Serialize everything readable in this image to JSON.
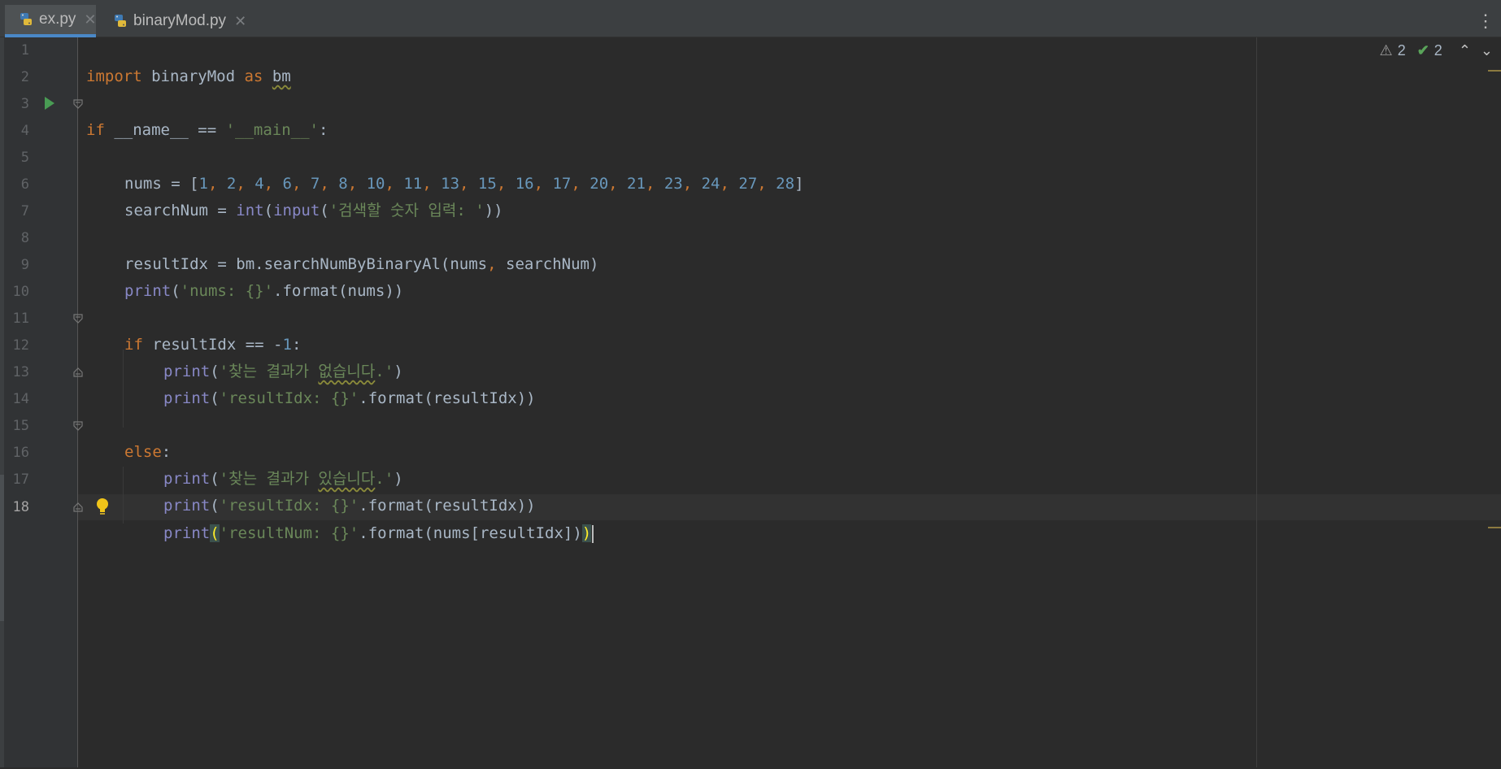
{
  "tabs": [
    {
      "label": "ex.py",
      "active": true
    },
    {
      "label": "binaryMod.py",
      "active": false
    }
  ],
  "inspections": {
    "warnings": "2",
    "ok": "2"
  },
  "current_line": 18,
  "colors": {
    "background": "#2b2b2b",
    "keyword": "#cc7832",
    "string": "#6a8759",
    "number": "#6897bb",
    "builtin": "#8888c6",
    "text": "#a9b7c6",
    "run_icon": "#499c54",
    "tab_underline": "#4a88c7"
  },
  "code": {
    "l1": [
      "import",
      " binaryMod ",
      "as",
      " ",
      "bm"
    ],
    "l3": [
      "if",
      " __name__ == ",
      "'__main__'",
      ":"
    ],
    "l5": [
      "nums = [",
      "1",
      ", ",
      "2",
      ", ",
      "4",
      ", ",
      "6",
      ", ",
      "7",
      ", ",
      "8",
      ", ",
      "10",
      ", ",
      "11",
      ", ",
      "13",
      ", ",
      "15",
      ", ",
      "16",
      ", ",
      "17",
      ", ",
      "20",
      ", ",
      "21",
      ", ",
      "23",
      ", ",
      "24",
      ", ",
      "27",
      ", ",
      "28",
      "]"
    ],
    "l6": [
      "searchNum = ",
      "int",
      "(",
      "input",
      "(",
      "'검색할 숫자 입력: '",
      "))"
    ],
    "l8": [
      "resultIdx = bm.searchNumByBinaryAl(nums",
      ", ",
      "searchNum)"
    ],
    "l9": [
      "print",
      "(",
      "'nums: {}'",
      ".format(nums))"
    ],
    "l11": [
      "if",
      " resultIdx == -",
      "1",
      ":"
    ],
    "l12": [
      "print",
      "(",
      "'찾는 결과가 ",
      "없습니다",
      ".'",
      ")"
    ],
    "l13": [
      "print",
      "(",
      "'resultIdx: {}'",
      ".format(resultIdx))"
    ],
    "l15": [
      "else",
      ":"
    ],
    "l16": [
      "print",
      "(",
      "'찾는 결과가 ",
      "있습니다",
      ".'",
      ")"
    ],
    "l17": [
      "print",
      "(",
      "'resultIdx: {}'",
      ".format(resultIdx))"
    ],
    "l18": [
      "print",
      "(",
      "'resultNum: {}'",
      ".format(nums[resultIdx])",
      ")"
    ]
  },
  "line_numbers": [
    "1",
    "2",
    "3",
    "4",
    "5",
    "6",
    "7",
    "8",
    "9",
    "10",
    "11",
    "12",
    "13",
    "14",
    "15",
    "16",
    "17",
    "18"
  ]
}
